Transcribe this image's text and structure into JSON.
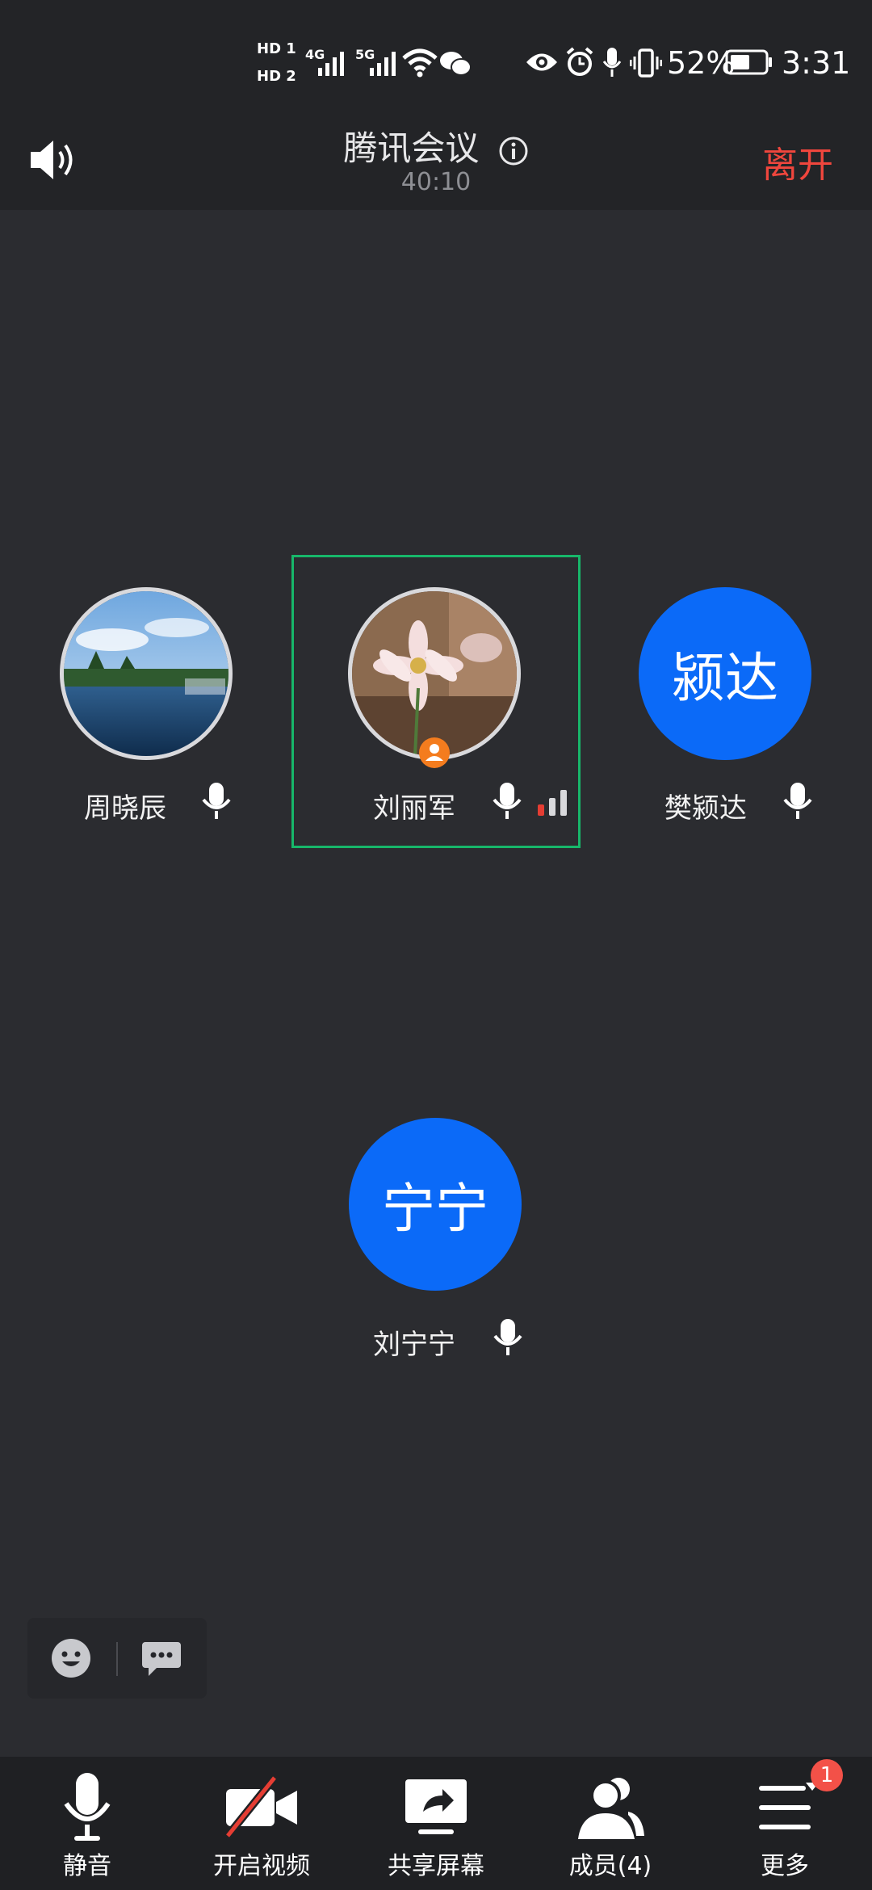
{
  "status_bar": {
    "sim1": "HD 1",
    "sim2": "HD 2",
    "net1": "4G",
    "net2": "5G",
    "battery_percent": "52%",
    "time": "3:31"
  },
  "header": {
    "title": "腾讯会议",
    "elapsed": "40:10",
    "leave_label": "离开"
  },
  "participants": [
    {
      "name": "周晓辰",
      "avatar_type": "photo-lake"
    },
    {
      "name": "刘丽军",
      "avatar_type": "photo-flower",
      "active": true
    },
    {
      "name": "樊颍达",
      "avatar_type": "text",
      "avatar_text": "颍达"
    },
    {
      "name": "刘宁宁",
      "avatar_type": "text",
      "avatar_text": "宁宁"
    }
  ],
  "toolbar": {
    "mute_label": "静音",
    "video_label": "开启视频",
    "share_label": "共享屏幕",
    "members_label": "成员(4)",
    "more_label": "更多",
    "more_badge": "1"
  },
  "colors": {
    "accent_blue": "#0b6af8",
    "leave_red": "#f0463d",
    "active_green": "#17b76a"
  }
}
